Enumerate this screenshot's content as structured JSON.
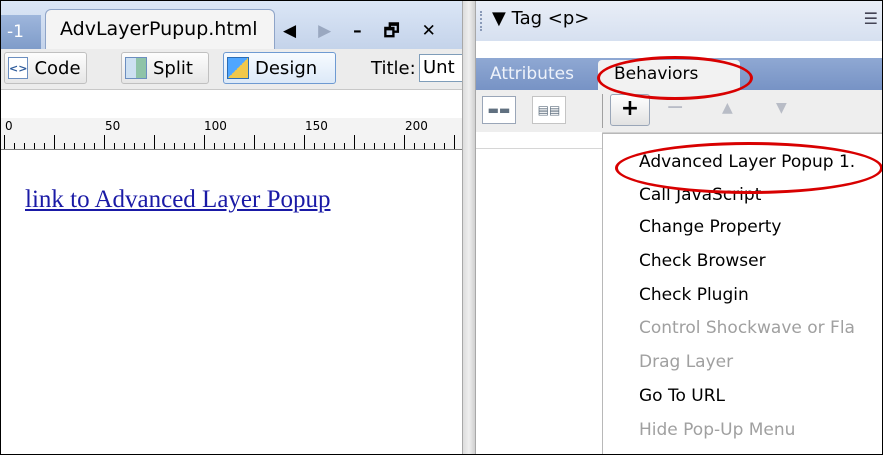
{
  "document": {
    "prev_tab_label": "-1",
    "active_tab_label": "AdvLayerPupup.html",
    "window_controls": {
      "prev": "◀",
      "next": "▶",
      "minimize": "–",
      "restore": "🗗",
      "close": "✕"
    },
    "toolbar": {
      "code_label": "Code",
      "split_label": "Split",
      "design_label": "Design",
      "title_label": "Title:",
      "title_value": "Unt"
    },
    "ruler_labels": [
      "0",
      "50",
      "100",
      "150",
      "200"
    ],
    "link_text": "link to Advanced Layer Popup"
  },
  "panel": {
    "title": "▼ Tag <p>",
    "menu_icon": "☰",
    "tabs": {
      "attributes": "Attributes",
      "behaviors": "Behaviors"
    },
    "toolbar": {
      "plus": "+",
      "minus": "−",
      "up": "▲",
      "down": "▼"
    },
    "menu_items": [
      {
        "label": "Advanced Layer Popup 1.",
        "enabled": true
      },
      {
        "label": "Call JavaScript",
        "enabled": true
      },
      {
        "label": "Change Property",
        "enabled": true
      },
      {
        "label": "Check Browser",
        "enabled": true
      },
      {
        "label": "Check Plugin",
        "enabled": true
      },
      {
        "label": "Control Shockwave or Fla",
        "enabled": false
      },
      {
        "label": "Drag Layer",
        "enabled": false
      },
      {
        "label": "Go To URL",
        "enabled": true
      },
      {
        "label": "Hide Pop-Up Menu",
        "enabled": false
      }
    ]
  },
  "colors": {
    "annotation_red": "#d80000",
    "link_blue": "#1a1aa6",
    "tab_blue": "#7793c5"
  }
}
